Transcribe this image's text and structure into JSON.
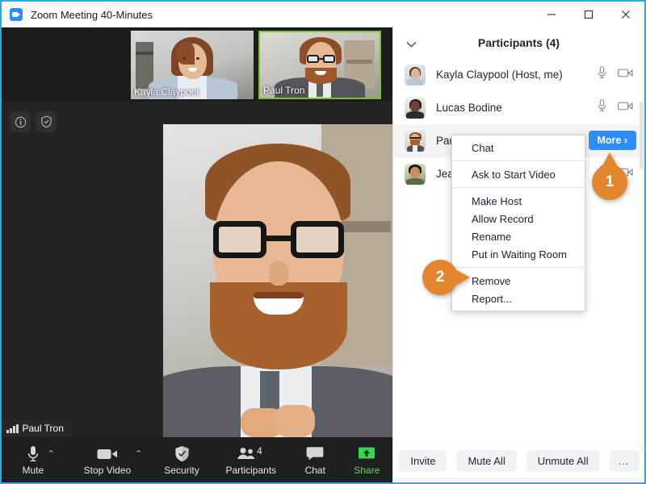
{
  "window": {
    "title": "Zoom Meeting 40-Minutes",
    "app_icon": "zoom-camera-icon",
    "controls": {
      "minimize": "minimize-icon",
      "maximize": "maximize-icon",
      "close": "close-icon"
    }
  },
  "stage": {
    "overlay_buttons": [
      {
        "icon": "info-icon"
      },
      {
        "icon": "shield-icon"
      }
    ],
    "active_speaker": {
      "name": "Paul Tron",
      "signal_icon": "signal-bars-icon"
    },
    "thumbnails": [
      {
        "name": "Kayla Claypool",
        "active": false
      },
      {
        "name": "Paul Tron",
        "active": true
      }
    ]
  },
  "toolbar": {
    "items": [
      {
        "label": "Mute",
        "icon": "microphone-icon",
        "caret": "⌃",
        "has_caret": true
      },
      {
        "label": "Stop Video",
        "icon": "video-camera-icon",
        "caret": "⌃",
        "has_caret": true
      },
      {
        "label": "Security",
        "icon": "shield-icon",
        "has_caret": false
      },
      {
        "label": "Participants",
        "icon": "participants-icon",
        "badge": "4",
        "has_caret": false
      },
      {
        "label": "Chat",
        "icon": "chat-bubble-icon",
        "has_caret": false
      },
      {
        "label": "Share",
        "icon": "share-screen-icon",
        "has_caret": false
      }
    ]
  },
  "panel": {
    "title": "Participants (4)",
    "collapse_icon": "chevron-down-icon",
    "more_button": "More ›",
    "participants": [
      {
        "name": "Kayla Claypool (Host, me)",
        "mic": "microphone-icon",
        "video": "video-camera-icon",
        "hover": false
      },
      {
        "name": "Lucas Bodine",
        "mic": "microphone-icon",
        "video": "video-camera-icon",
        "hover": false
      },
      {
        "name": "Paul Tron",
        "mic": "microphone-icon",
        "video": "video-camera-icon",
        "hover": true
      },
      {
        "name": "Jean Dubois",
        "mic": "microphone-icon",
        "video": "video-camera-icon",
        "hover": false
      }
    ],
    "footer_buttons": [
      {
        "label": "Invite"
      },
      {
        "label": "Mute All"
      },
      {
        "label": "Unmute All"
      },
      {
        "label": "…"
      }
    ]
  },
  "context_menu": {
    "groups": [
      {
        "items": [
          {
            "label": "Chat"
          }
        ]
      },
      {
        "items": [
          {
            "label": "Ask to Start Video"
          }
        ]
      },
      {
        "items": [
          {
            "label": "Make Host"
          },
          {
            "label": "Allow Record"
          },
          {
            "label": "Rename"
          },
          {
            "label": "Put in Waiting Room"
          }
        ]
      },
      {
        "items": [
          {
            "label": "Remove"
          },
          {
            "label": "Report..."
          }
        ]
      }
    ]
  },
  "callouts": [
    {
      "number": "1",
      "points_to": "more-button"
    },
    {
      "number": "2",
      "points_to": "remove-menu-item"
    }
  ],
  "colors": {
    "accent_blue": "#2d8cff",
    "window_border": "#2aace2",
    "callout_orange": "#e3862e",
    "active_video_border": "#7ec225",
    "share_green": "#5ed863",
    "stage_dark": "#242424"
  }
}
